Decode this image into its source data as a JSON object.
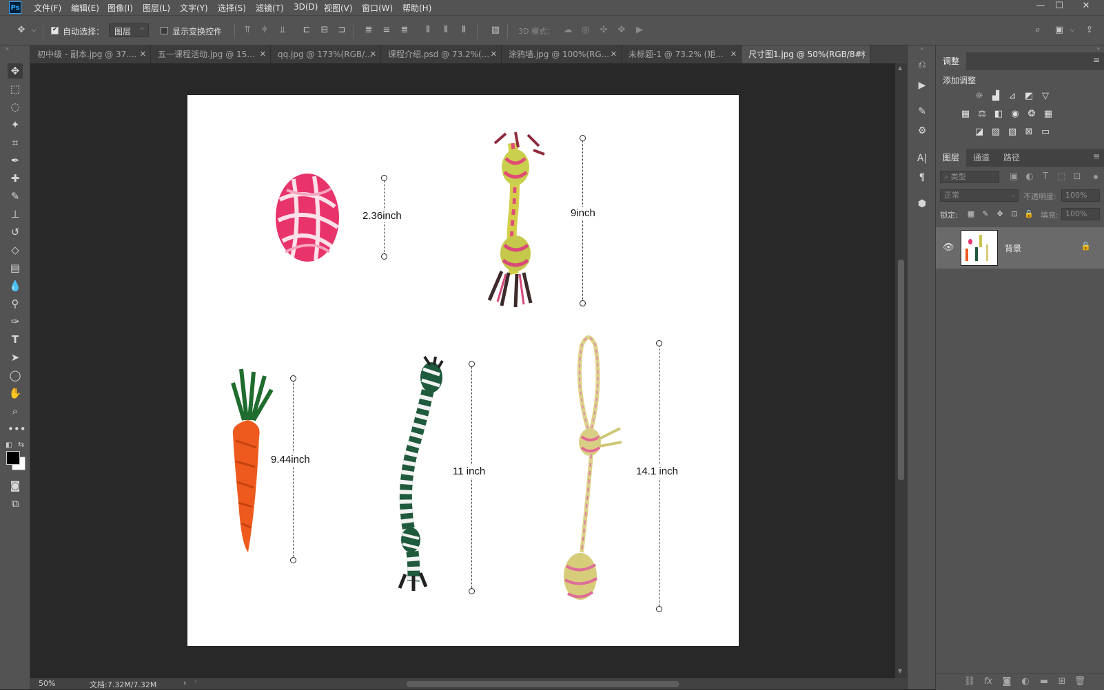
{
  "app": {
    "logo": "Ps"
  },
  "menu": [
    "文件(F)",
    "编辑(E)",
    "图像(I)",
    "图层(L)",
    "文字(Y)",
    "选择(S)",
    "滤镜(T)",
    "3D(D)",
    "视图(V)",
    "窗口(W)",
    "帮助(H)"
  ],
  "window_controls": {
    "minimize": "—",
    "maximize": "☐",
    "close": "✕"
  },
  "options": {
    "auto_select_label": "自动选择：",
    "auto_select_checked": true,
    "target_value": "图层",
    "show_transform_label": "显示变换控件",
    "show_transform_checked": false,
    "mode_3d_label": "3D 模式："
  },
  "tabs": [
    {
      "label": "初中级 - 副本.jpg @ 37....",
      "active": false
    },
    {
      "label": "五一课程活动.jpg @ 15...",
      "active": false
    },
    {
      "label": "qq.jpg @ 173%(RGB/...",
      "active": false
    },
    {
      "label": "课程介绍.psd @ 73.2%(...",
      "active": false
    },
    {
      "label": "涂鸦墙.jpg @ 100%(RG...",
      "active": false
    },
    {
      "label": "未标题-1 @ 73.2% (矩...",
      "active": false
    },
    {
      "label": "尺寸图1.jpg @ 50%(RGB/8#)",
      "active": true
    }
  ],
  "tab_close": "✕",
  "canvas": {
    "measurements": [
      {
        "label": "2.36inch",
        "item": "rope-ball-toy"
      },
      {
        "label": "9inch",
        "item": "knotted-rope-toy"
      },
      {
        "label": "9.44inch",
        "item": "carrot-rope-toy"
      },
      {
        "label": "11 inch",
        "item": "green-rope-toy"
      },
      {
        "label": "14.1 inch",
        "item": "ball-loop-rope-toy"
      }
    ]
  },
  "status": {
    "zoom": "50%",
    "doc_info": "文档:7.32M/7.32M",
    "arrow": "›"
  },
  "adjustments_panel": {
    "tab": "调整",
    "title": "添加调整"
  },
  "layers_panel": {
    "tabs": [
      "图层",
      "通道",
      "路径"
    ],
    "filter_placeholder": "类型",
    "blend_mode": "正常",
    "opacity_label": "不透明度:",
    "opacity_value": "100%",
    "lock_label": "锁定:",
    "fill_label": "填充:",
    "fill_value": "100%",
    "layer_name": "背景"
  },
  "colors": {
    "ps_blue": "#31a8ff",
    "panel_bg": "#535353",
    "canvas_bg": "#282828"
  }
}
